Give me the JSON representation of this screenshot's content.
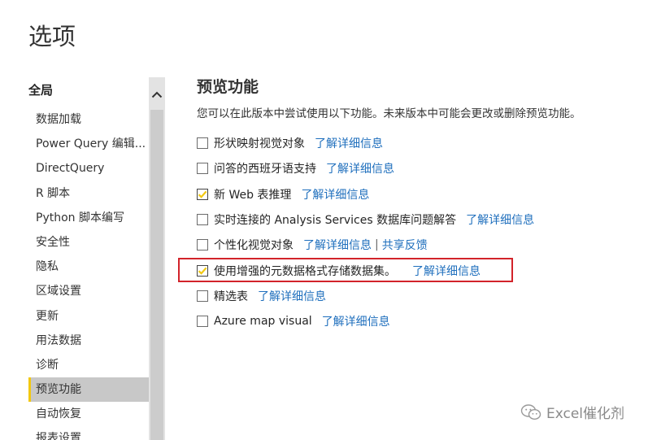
{
  "dialog": {
    "title": "选项"
  },
  "sidebar": {
    "heading": "全局",
    "items": [
      {
        "label": "数据加载"
      },
      {
        "label": "Power Query 编辑..."
      },
      {
        "label": "DirectQuery"
      },
      {
        "label": "R 脚本"
      },
      {
        "label": "Python 脚本编写"
      },
      {
        "label": "安全性"
      },
      {
        "label": "隐私"
      },
      {
        "label": "区域设置"
      },
      {
        "label": "更新"
      },
      {
        "label": "用法数据"
      },
      {
        "label": "诊断"
      },
      {
        "label": "预览功能",
        "active": true
      },
      {
        "label": "自动恢复"
      },
      {
        "label": "报表设置"
      }
    ]
  },
  "main": {
    "title": "预览功能",
    "description": "您可以在此版本中尝试使用以下功能。未来版本中可能会更改或删除预览功能。",
    "features": [
      {
        "label": "形状映射视觉对象",
        "checked": false,
        "link": "了解详细信息"
      },
      {
        "label": "问答的西班牙语支持",
        "checked": false,
        "link": "了解详细信息"
      },
      {
        "label": "新 Web 表推理",
        "checked": true,
        "link": "了解详细信息"
      },
      {
        "label": "实时连接的 Analysis Services 数据库问题解答",
        "checked": false,
        "link": "了解详细信息"
      },
      {
        "label": "个性化视觉对象",
        "checked": false,
        "link": "了解详细信息",
        "separator": "|",
        "extra_link": "共享反馈"
      },
      {
        "label": "使用增强的元数据格式存储数据集。",
        "checked": true,
        "link": "了解详细信息",
        "highlighted": true
      },
      {
        "label": "精选表",
        "checked": false,
        "link": "了解详细信息"
      },
      {
        "label": "Azure map visual",
        "checked": false,
        "link": "了解详细信息"
      }
    ]
  },
  "watermark": {
    "text": "Excel催化剂"
  },
  "colors": {
    "link": "#1f6fbd",
    "highlight_border": "#d2232a",
    "active_accent": "#f2c811",
    "checkmark": "#f2c811"
  }
}
